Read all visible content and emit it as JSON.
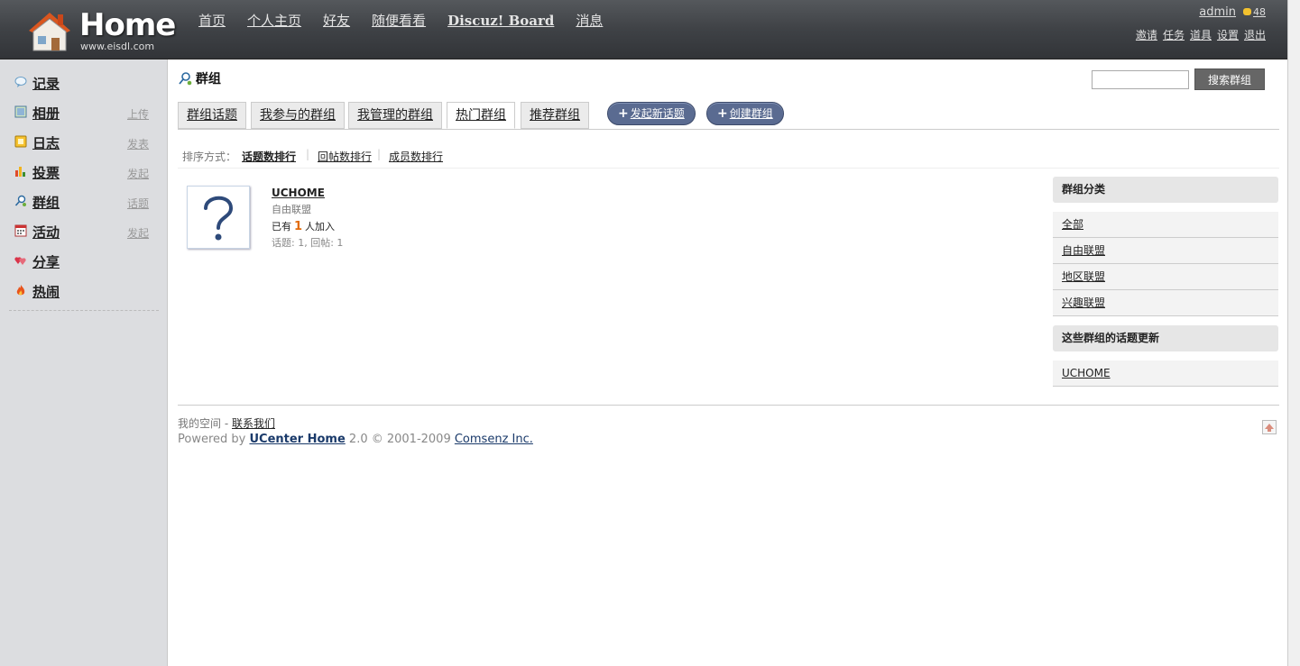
{
  "header": {
    "logo_word": "Home",
    "logo_url": "www.eisdl.com",
    "nav": [
      "首页",
      "个人主页",
      "好友",
      "随便看看",
      "Discuz! Board",
      "消息"
    ],
    "user": "admin",
    "coins": "48",
    "links": [
      "邀请",
      "任务",
      "道具",
      "设置",
      "退出"
    ]
  },
  "sidebar": {
    "items": [
      {
        "label": "记录",
        "action": "",
        "icon": "speech-bubble-icon"
      },
      {
        "label": "相册",
        "action": "上传",
        "icon": "photo-icon"
      },
      {
        "label": "日志",
        "action": "发表",
        "icon": "notebook-icon"
      },
      {
        "label": "投票",
        "action": "发起",
        "icon": "bar-chart-icon"
      },
      {
        "label": "群组",
        "action": "话题",
        "icon": "group-icon"
      },
      {
        "label": "活动",
        "action": "发起",
        "icon": "calendar-icon"
      },
      {
        "label": "分享",
        "action": "",
        "icon": "hearts-icon"
      },
      {
        "label": "热闹",
        "action": "",
        "icon": "fire-icon"
      }
    ]
  },
  "page": {
    "title": "群组",
    "search_button": "搜索群组"
  },
  "tabs": [
    "群组话题",
    "我参与的群组",
    "我管理的群组",
    "热门群组",
    "推荐群组"
  ],
  "active_tab": "热门群组",
  "actions": [
    "发起新话题",
    "创建群组"
  ],
  "sort": {
    "label": "排序方式：",
    "options": [
      "话题数排行",
      "回帖数排行",
      "成员数排行"
    ]
  },
  "group": {
    "name": "UCHOME",
    "category": "自由联盟",
    "members_prefix": "已有",
    "members_count": "1",
    "members_suffix": "人加入",
    "stats": "话题: 1, 回帖: 1"
  },
  "panel": {
    "categories_title": "群组分类",
    "categories": [
      "全部",
      "自由联盟",
      "地区联盟",
      "兴趣联盟"
    ],
    "updates_title": "这些群组的话题更新",
    "updates": [
      "UCHOME"
    ]
  },
  "footer": {
    "line1_prefix": "我的空间",
    "line1_sep": " - ",
    "contact": "联系我们",
    "powered_prefix": "Powered by ",
    "product": "UCenter Home",
    "version": " 2.0 © 2001-2009 ",
    "company": "Comsenz Inc."
  },
  "colors": {
    "header": "#3f4246",
    "sidebar": "#dcdde0",
    "pill": "#5a6b91",
    "highlight": "#e26b0b"
  }
}
